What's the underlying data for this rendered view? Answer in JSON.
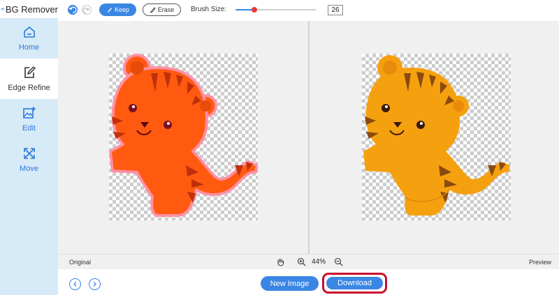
{
  "app": {
    "title": "BG Remover"
  },
  "sidebar": {
    "items": [
      {
        "label": "Home",
        "icon": "home-icon"
      },
      {
        "label": "Edge Refine",
        "icon": "edit-square-icon",
        "active": true
      },
      {
        "label": "Edit",
        "icon": "image-edit-icon"
      },
      {
        "label": "Move",
        "icon": "move-icon"
      }
    ]
  },
  "toolbar": {
    "keep_label": "Keep",
    "erase_label": "Erase",
    "brush_label": "Brush Size:",
    "brush_value": "26"
  },
  "canvas": {
    "original_label": "Original",
    "preview_label": "Preview",
    "zoom": "44%"
  },
  "footer": {
    "new_image_label": "New Image",
    "download_label": "Download"
  },
  "colors": {
    "accent": "#3a86e5",
    "sidebar_bg": "#d6eaf8",
    "highlight": "#c8102e",
    "original_tiger": "#ff5a10",
    "preview_tiger": "#f5a00e"
  }
}
